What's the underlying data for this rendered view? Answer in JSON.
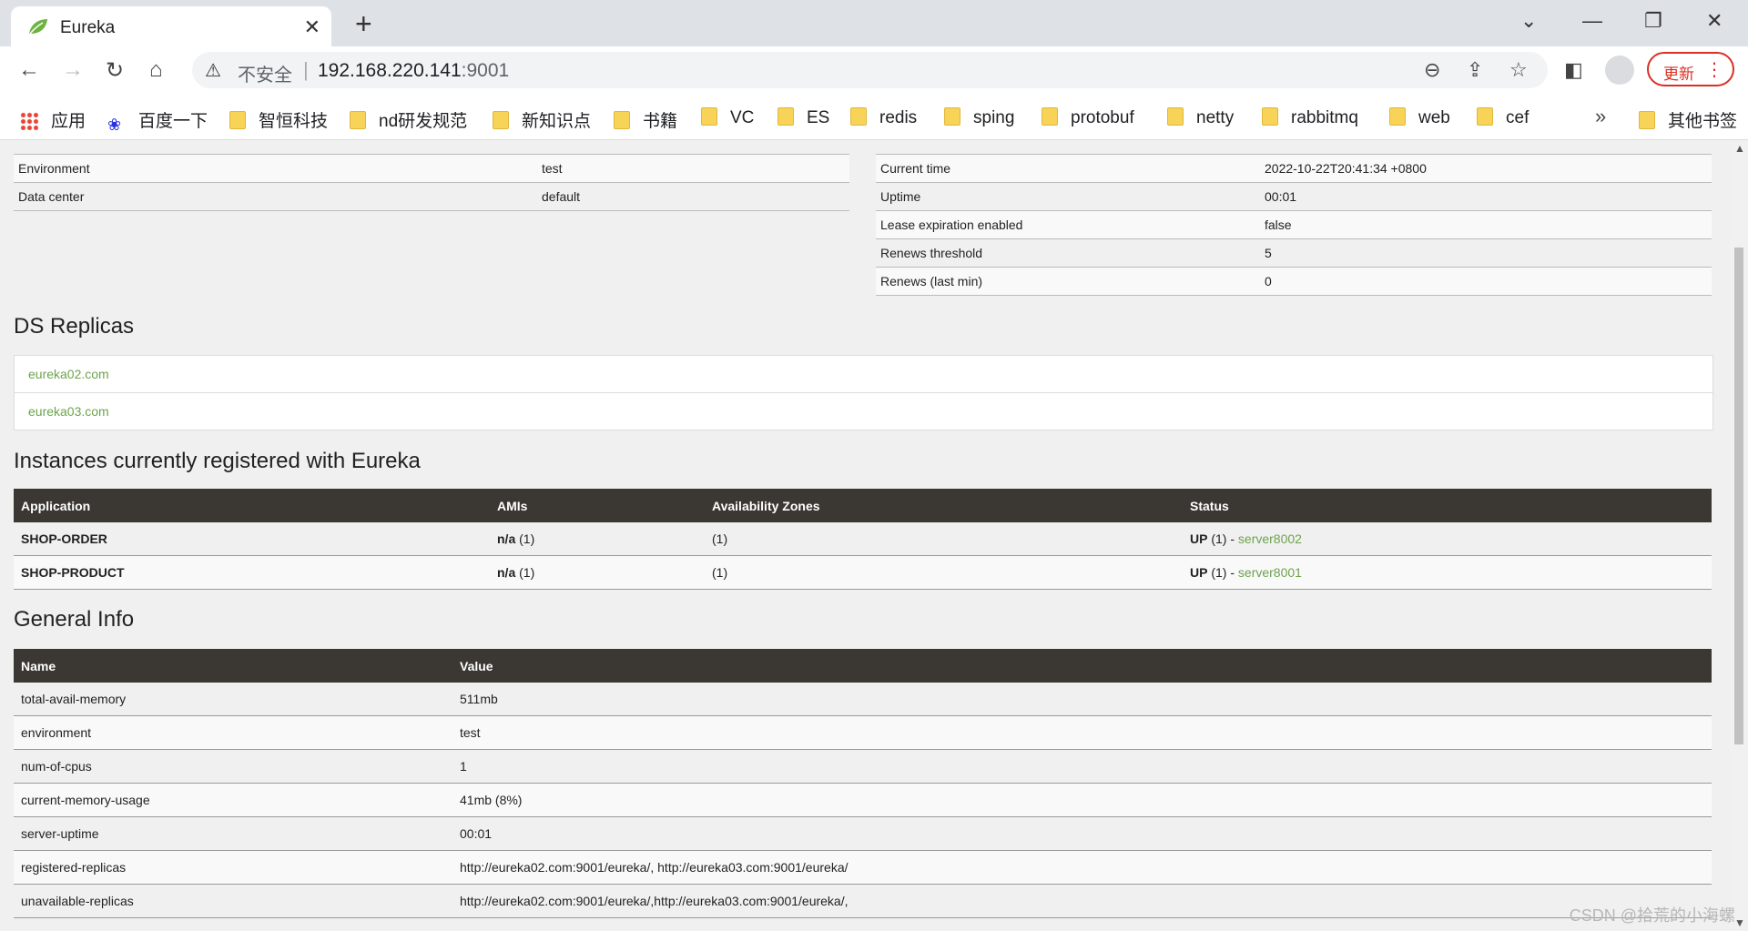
{
  "browser": {
    "tab_title": "Eureka",
    "address_insecure": "不安全",
    "address_host": "192.168.220.141",
    "address_port": ":9001",
    "update_label": "更新",
    "bookmarks": [
      "应用",
      "百度一下",
      "智恒科技",
      "nd研发规范",
      "新知识点",
      "书籍",
      "VC",
      "ES",
      "redis",
      "sping",
      "protobuf",
      "netty",
      "rabbitmq",
      "web",
      "cef"
    ],
    "other_bookmarks": "其他书签"
  },
  "system_left": [
    {
      "key": "Environment",
      "value": "test"
    },
    {
      "key": "Data center",
      "value": "default"
    }
  ],
  "system_right": [
    {
      "key": "Current time",
      "value": "2022-10-22T20:41:34 +0800"
    },
    {
      "key": "Uptime",
      "value": "00:01"
    },
    {
      "key": "Lease expiration enabled",
      "value": "false"
    },
    {
      "key": "Renews threshold",
      "value": "5"
    },
    {
      "key": "Renews (last min)",
      "value": "0"
    }
  ],
  "ds_replicas": {
    "title": "DS Replicas",
    "items": [
      "eureka02.com",
      "eureka03.com"
    ]
  },
  "instances": {
    "title": "Instances currently registered with Eureka",
    "headers": [
      "Application",
      "AMIs",
      "Availability Zones",
      "Status"
    ],
    "rows": [
      {
        "app": "SHOP-ORDER",
        "ami": "n/a",
        "ami_count": " (1)",
        "zones": "(1)",
        "status": "UP",
        "status_count": " (1) - ",
        "instance": "server8002"
      },
      {
        "app": "SHOP-PRODUCT",
        "ami": "n/a",
        "ami_count": " (1)",
        "zones": "(1)",
        "status": "UP",
        "status_count": " (1) - ",
        "instance": "server8001"
      }
    ]
  },
  "general_info": {
    "title": "General Info",
    "headers": [
      "Name",
      "Value"
    ],
    "rows": [
      {
        "name": "total-avail-memory",
        "value": "511mb"
      },
      {
        "name": "environment",
        "value": "test"
      },
      {
        "name": "num-of-cpus",
        "value": "1"
      },
      {
        "name": "current-memory-usage",
        "value": "41mb (8%)"
      },
      {
        "name": "server-uptime",
        "value": "00:01"
      },
      {
        "name": "registered-replicas",
        "value": "http://eureka02.com:9001/eureka/, http://eureka03.com:9001/eureka/"
      },
      {
        "name": "unavailable-replicas",
        "value": "http://eureka02.com:9001/eureka/,http://eureka03.com:9001/eureka/,"
      }
    ]
  },
  "watermark": "CSDN @拾荒的小海螺"
}
